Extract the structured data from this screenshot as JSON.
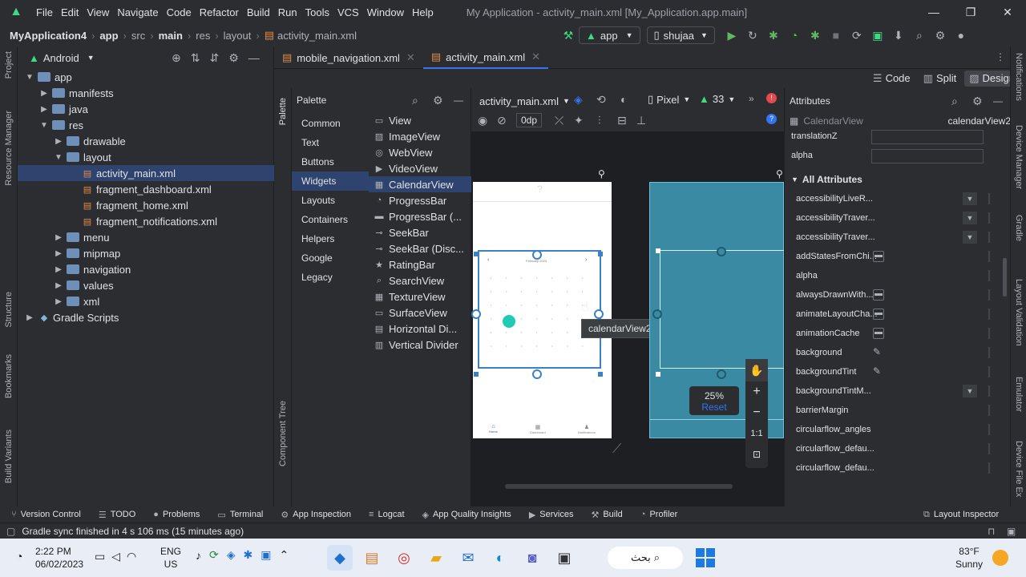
{
  "menubar": {
    "items": [
      "File",
      "Edit",
      "View",
      "Navigate",
      "Code",
      "Refactor",
      "Build",
      "Run",
      "Tools",
      "VCS",
      "Window",
      "Help"
    ],
    "title": "My Application - activity_main.xml [My_Application.app.main]"
  },
  "navbar": {
    "crumbs": [
      "MyApplication4",
      "app",
      "src",
      "main",
      "res",
      "layout",
      "activity_main.xml"
    ],
    "run_config": "app",
    "device": "shujaa"
  },
  "project": {
    "view_mode": "Android",
    "tree": [
      {
        "label": "app",
        "depth": 0,
        "open": true,
        "kind": "folder"
      },
      {
        "label": "manifests",
        "depth": 1,
        "open": false,
        "kind": "folder"
      },
      {
        "label": "java",
        "depth": 1,
        "open": false,
        "kind": "folder"
      },
      {
        "label": "res",
        "depth": 1,
        "open": true,
        "kind": "folder"
      },
      {
        "label": "drawable",
        "depth": 2,
        "open": false,
        "kind": "folder"
      },
      {
        "label": "layout",
        "depth": 2,
        "open": true,
        "kind": "folder"
      },
      {
        "label": "activity_main.xml",
        "depth": 3,
        "kind": "xml",
        "selected": true
      },
      {
        "label": "fragment_dashboard.xml",
        "depth": 3,
        "kind": "xml"
      },
      {
        "label": "fragment_home.xml",
        "depth": 3,
        "kind": "xml"
      },
      {
        "label": "fragment_notifications.xml",
        "depth": 3,
        "kind": "xml"
      },
      {
        "label": "menu",
        "depth": 2,
        "open": false,
        "kind": "folder"
      },
      {
        "label": "mipmap",
        "depth": 2,
        "open": false,
        "kind": "folder"
      },
      {
        "label": "navigation",
        "depth": 2,
        "open": false,
        "kind": "folder"
      },
      {
        "label": "values",
        "depth": 2,
        "open": false,
        "kind": "folder"
      },
      {
        "label": "xml",
        "depth": 2,
        "open": false,
        "kind": "folder"
      },
      {
        "label": "Gradle Scripts",
        "depth": 0,
        "open": false,
        "kind": "gradle"
      }
    ]
  },
  "left_strip": {
    "project": "Project",
    "resource_manager": "Resource Manager",
    "structure": "Structure",
    "bookmarks": "Bookmarks",
    "build_variants": "Build Variants"
  },
  "editor": {
    "tabs": [
      {
        "label": "mobile_navigation.xml",
        "active": false
      },
      {
        "label": "activity_main.xml",
        "active": true
      }
    ],
    "modes": [
      "Code",
      "Split",
      "Design"
    ],
    "active_mode": "Design"
  },
  "palette": {
    "title": "Palette",
    "strip_label": "Palette",
    "component_tree": "Component Tree",
    "categories": [
      "Common",
      "Text",
      "Buttons",
      "Widgets",
      "Layouts",
      "Containers",
      "Helpers",
      "Google",
      "Legacy"
    ],
    "selected_category": "Widgets",
    "widgets": [
      "View",
      "ImageView",
      "WebView",
      "VideoView",
      "CalendarView",
      "ProgressBar",
      "ProgressBar (...",
      "SeekBar",
      "SeekBar (Disc...",
      "RatingBar",
      "SearchView",
      "TextureView",
      "SurfaceView",
      "Horizontal Di...",
      "Vertical Divider"
    ],
    "selected_widget": "CalendarView"
  },
  "design": {
    "file": "activity_main.xml",
    "device": "Pixel",
    "api": "33",
    "margin": "0dp",
    "tooltip": "calendarView2",
    "zoom": "25%",
    "reset": "Reset",
    "one_to_one": "1:1",
    "phone_nav": [
      "Home",
      "Dashboard",
      "Notifications"
    ],
    "calendar_month": "February 2023"
  },
  "attributes": {
    "title": "Attributes",
    "component": "CalendarView",
    "component_id": "calendarView2",
    "top_rows": [
      "translationZ",
      "alpha"
    ],
    "section": "All Attributes",
    "rows": [
      {
        "name": "accessibilityLiveR...",
        "ctl": "dd"
      },
      {
        "name": "accessibilityTraver...",
        "ctl": "dd"
      },
      {
        "name": "accessibilityTraver...",
        "ctl": "dd"
      },
      {
        "name": "addStatesFromChi...",
        "ctl": "flag"
      },
      {
        "name": "alpha",
        "ctl": ""
      },
      {
        "name": "alwaysDrawnWith...",
        "ctl": "flag"
      },
      {
        "name": "animateLayoutCha...",
        "ctl": "flag"
      },
      {
        "name": "animationCache",
        "ctl": "flag"
      },
      {
        "name": "background",
        "ctl": "pick"
      },
      {
        "name": "backgroundTint",
        "ctl": "pick"
      },
      {
        "name": "backgroundTintM...",
        "ctl": "dd"
      },
      {
        "name": "barrierMargin",
        "ctl": ""
      },
      {
        "name": "circularflow_angles",
        "ctl": ""
      },
      {
        "name": "circularflow_defau...",
        "ctl": ""
      },
      {
        "name": "circularflow_defau...",
        "ctl": ""
      }
    ]
  },
  "right_strip": [
    "Notifications",
    "Device Manager",
    "Gradle",
    "Layout Validation",
    "Emulator",
    "Device File Ex"
  ],
  "bottom_tools": [
    "Version Control",
    "TODO",
    "Problems",
    "Terminal",
    "App Inspection",
    "Logcat",
    "App Quality Insights",
    "Services",
    "Build",
    "Profiler"
  ],
  "layout_inspector": "Layout Inspector",
  "status": "Gradle sync finished in 4 s 106 ms (15 minutes ago)",
  "taskbar": {
    "time": "2:22 PM",
    "date": "06/02/2023",
    "lang1": "ENG",
    "lang2": "US",
    "search": "بحث",
    "temp": "83°F",
    "weather": "Sunny"
  },
  "colors": {
    "accent": "#3574f0",
    "selection": "#2e436e",
    "blueprint": "#3b8aa3",
    "teal": "#1ecbb5",
    "android_green": "#3ddc84"
  }
}
